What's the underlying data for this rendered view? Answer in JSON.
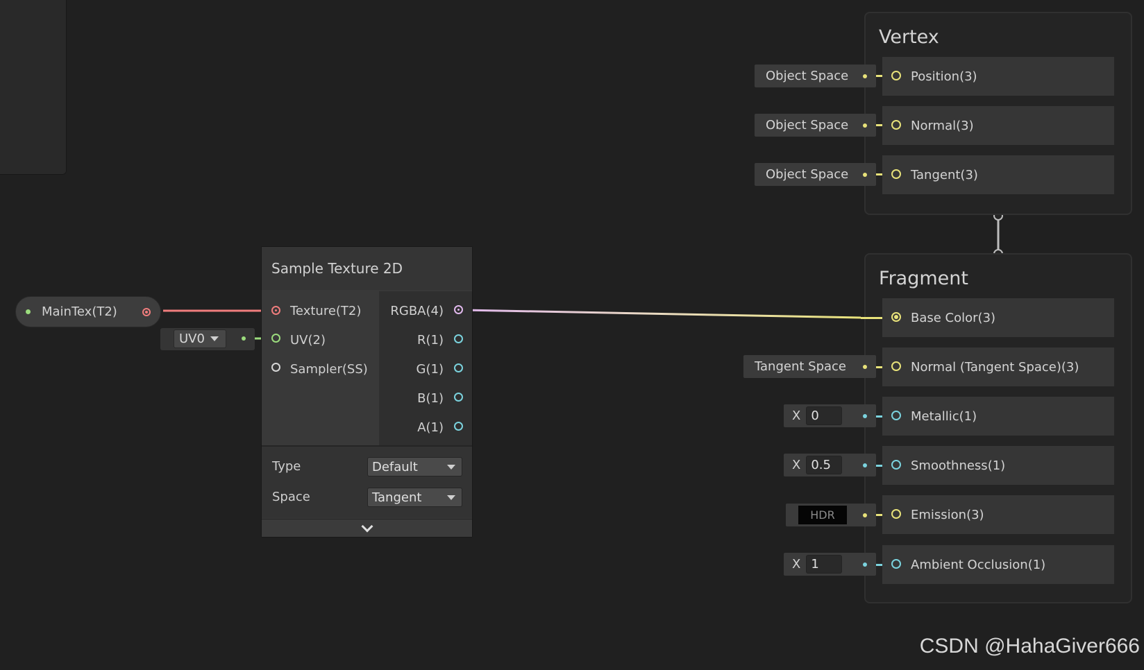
{
  "colors": {
    "background": "#202020",
    "texture_wire": "#f07d7d",
    "vector2_wire": "#9bdc7d",
    "vector3_wire": "#e8e27a",
    "float_wire": "#7bd3de",
    "vector4_wire": "#e0b8ec"
  },
  "property_node": {
    "label": "MainTex(T2)"
  },
  "uv_input": {
    "value": "UV0"
  },
  "sample_texture": {
    "title": "Sample Texture 2D",
    "inputs": [
      "Texture(T2)",
      "UV(2)",
      "Sampler(SS)"
    ],
    "outputs": [
      "RGBA(4)",
      "R(1)",
      "G(1)",
      "B(1)",
      "A(1)"
    ],
    "type_label": "Type",
    "type_value": "Default",
    "space_label": "Space",
    "space_value": "Tangent",
    "expand_icon": "chevron-down-icon"
  },
  "vertex": {
    "title": "Vertex",
    "slots": [
      {
        "label": "Position(3)",
        "input": "Object Space"
      },
      {
        "label": "Normal(3)",
        "input": "Object Space"
      },
      {
        "label": "Tangent(3)",
        "input": "Object Space"
      }
    ]
  },
  "fragment": {
    "title": "Fragment",
    "slots": [
      {
        "label": "Base Color(3)"
      },
      {
        "label": "Normal (Tangent Space)(3)",
        "input": "Tangent Space"
      },
      {
        "label": "Metallic(1)",
        "axis": "X",
        "value": "0"
      },
      {
        "label": "Smoothness(1)",
        "axis": "X",
        "value": "0.5"
      },
      {
        "label": "Emission(3)",
        "hdr": "HDR"
      },
      {
        "label": "Ambient Occlusion(1)",
        "axis": "X",
        "value": "1"
      }
    ]
  },
  "watermark": "CSDN @HahaGiver666"
}
